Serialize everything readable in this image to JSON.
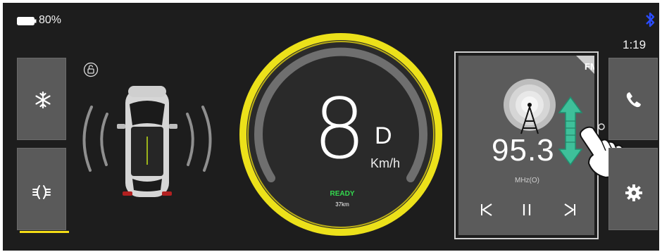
{
  "status_bar": {
    "battery_percent": 0.8,
    "battery_label": "80%",
    "bluetooth_icon": "bluetooth-icon",
    "time": "1:19"
  },
  "left_controls": [
    {
      "name": "climate-button",
      "icon": "snowflake-icon"
    },
    {
      "name": "defrost-button",
      "icon": "defrost-icon",
      "active": true
    }
  ],
  "lock_icon": "unlock-icon",
  "speedometer": {
    "speed": "8",
    "gear": "D",
    "unit": "Km/h",
    "status": "READY",
    "range": "37km"
  },
  "radio": {
    "band": "FM",
    "frequency": "95.3",
    "unit": "MHz(O)",
    "controls": [
      "previous-icon",
      "pause-icon",
      "next-icon"
    ]
  },
  "right_controls": [
    {
      "name": "phone-button",
      "icon": "phone-icon"
    },
    {
      "name": "settings-button",
      "icon": "gear-icon"
    }
  ],
  "colors": {
    "accent_yellow": "#f4dc16",
    "ready_green": "#33d94e",
    "bluetooth_blue": "#2a4cff",
    "gesture_arrow": "#3ec09a"
  }
}
